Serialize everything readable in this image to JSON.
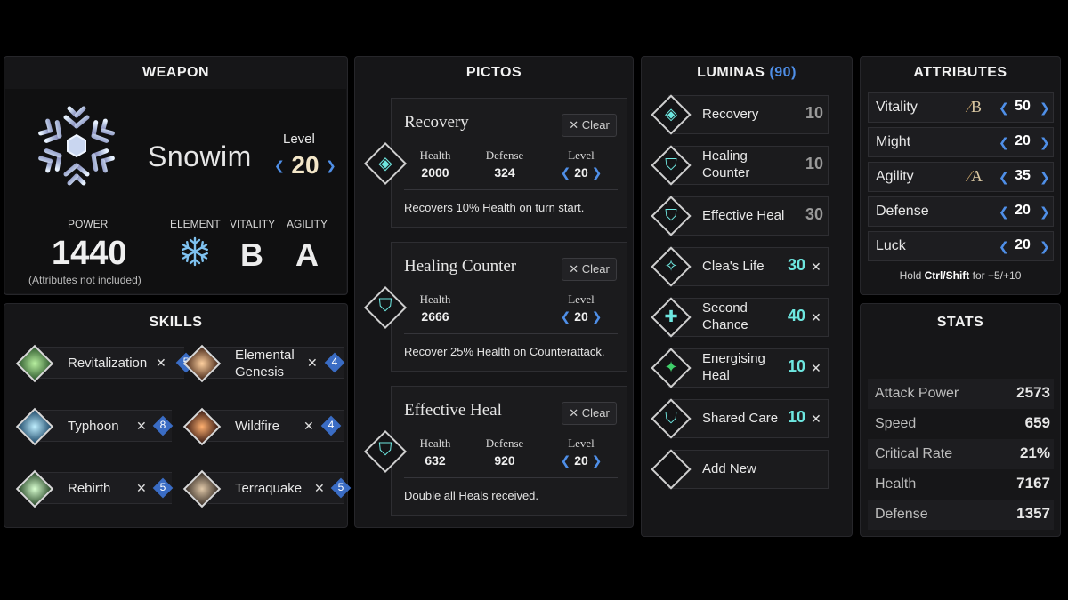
{
  "weapon": {
    "title": "WEAPON",
    "name": "Snowim",
    "level_label": "Level",
    "level": "20",
    "power_label": "POWER",
    "power": "1440",
    "power_note": "(Attributes not included)",
    "element_label": "ELEMENT",
    "vitality_label": "VITALITY",
    "vitality": "B",
    "agility_label": "AGILITY",
    "agility": "A",
    "icon": "snowflake-icon"
  },
  "skills": {
    "title": "SKILLS",
    "items": [
      {
        "name": "Revitalization",
        "level": "5",
        "icon": "revitalization-icon"
      },
      {
        "name": "Elemental Genesis",
        "level": "4",
        "icon": "elemental-genesis-icon"
      },
      {
        "name": "Typhoon",
        "level": "8",
        "icon": "typhoon-icon"
      },
      {
        "name": "Wildfire",
        "level": "4",
        "icon": "wildfire-icon"
      },
      {
        "name": "Rebirth",
        "level": "5",
        "icon": "rebirth-icon"
      },
      {
        "name": "Terraquake",
        "level": "5",
        "icon": "terraquake-icon"
      }
    ]
  },
  "pictos": {
    "title": "PICTOS",
    "clear_label": "Clear",
    "items": [
      {
        "name": "Recovery",
        "health_label": "Health",
        "health": "2000",
        "defense_label": "Defense",
        "defense": "324",
        "level_label": "Level",
        "level": "20",
        "description": "Recovers 10% Health on turn start."
      },
      {
        "name": "Healing Counter",
        "health_label": "Health",
        "health": "2666",
        "level_label": "Level",
        "level": "20",
        "description": "Recover 25% Health on Counterattack."
      },
      {
        "name": "Effective Heal",
        "health_label": "Health",
        "health": "632",
        "defense_label": "Defense",
        "defense": "920",
        "level_label": "Level",
        "level": "20",
        "description": "Double all Heals received."
      }
    ]
  },
  "luminas": {
    "title": "LUMINAS",
    "points": "(90)",
    "items": [
      {
        "name": "Recovery",
        "cost": "10",
        "removable": false
      },
      {
        "name": "Healing Counter",
        "cost": "10",
        "removable": false
      },
      {
        "name": "Effective Heal",
        "cost": "30",
        "removable": false
      },
      {
        "name": "Clea's Life",
        "cost": "30",
        "removable": true
      },
      {
        "name": "Second Chance",
        "cost": "40",
        "removable": true
      },
      {
        "name": "Energising Heal",
        "cost": "10",
        "removable": true
      },
      {
        "name": "Shared Care",
        "cost": "10",
        "removable": true
      }
    ],
    "add_new_label": "Add New"
  },
  "attributes": {
    "title": "ATTRIBUTES",
    "items": [
      {
        "name": "Vitality",
        "grade": "B",
        "value": "50"
      },
      {
        "name": "Might",
        "grade": "",
        "value": "20"
      },
      {
        "name": "Agility",
        "grade": "A",
        "value": "35"
      },
      {
        "name": "Defense",
        "grade": "",
        "value": "20"
      },
      {
        "name": "Luck",
        "grade": "",
        "value": "20"
      }
    ],
    "hint_prefix": "Hold",
    "hint_keys": "Ctrl/Shift",
    "hint_suffix": "for +5/+10"
  },
  "stats": {
    "title": "STATS",
    "items": [
      {
        "name": "Attack Power",
        "value": "2573"
      },
      {
        "name": "Speed",
        "value": "659"
      },
      {
        "name": "Critical Rate",
        "value": "21%"
      },
      {
        "name": "Health",
        "value": "7167"
      },
      {
        "name": "Defense",
        "value": "1357"
      }
    ]
  },
  "colors": {
    "accent": "#4f8fe8",
    "lumina_active_cost": "#6ee7e0",
    "lumina_inactive_cost": "#9a9a9a",
    "level_badge": "#3a6cc4"
  }
}
